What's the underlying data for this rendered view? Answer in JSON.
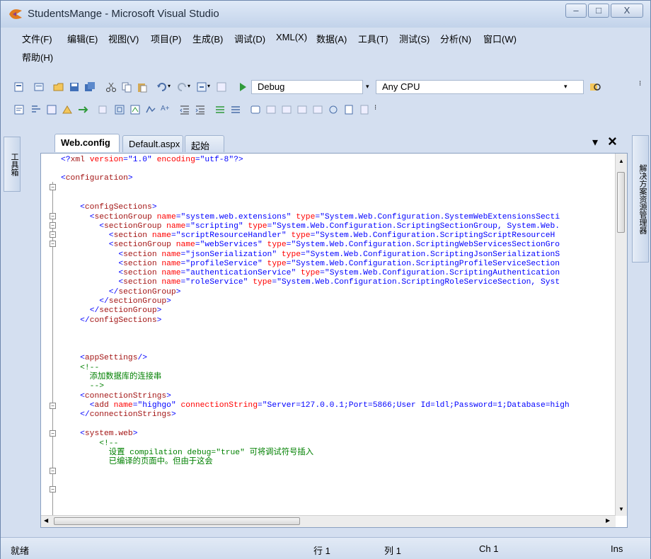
{
  "window": {
    "title": "StudentsMange - Microsoft Visual Studio",
    "minimize": "–",
    "maximize": "□",
    "close": "X"
  },
  "menu": [
    "文件(F)",
    "编辑(E)",
    "视图(V)",
    "项目(P)",
    "生成(B)",
    "调试(D)",
    "XML(X)",
    "数据(A)",
    "工具(T)",
    "测试(S)",
    "分析(N)",
    "窗口(W)",
    "帮助(H)"
  ],
  "toolbar": {
    "config_combo": "Debug",
    "platform_combo": "Any CPU"
  },
  "side_panels": {
    "left_toolbox": "工具箱",
    "right_solution_explorer": "解决方案资源管理器"
  },
  "tabs": [
    {
      "label": "Web.config",
      "active": true
    },
    {
      "label": "Default.aspx",
      "active": false
    },
    {
      "label": "起始页",
      "active": false
    }
  ],
  "tab_controls": {
    "dropdown": "▾",
    "close": "×"
  },
  "code_lines": [
    "<?xml version=\"1.0\" encoding=\"utf-8\"?>",
    "",
    "<configuration>",
    "",
    "",
    "    <configSections>",
    "      <sectionGroup name=\"system.web.extensions\" type=\"System.Web.Configuration.SystemWebExtensionsSecti",
    "        <sectionGroup name=\"scripting\" type=\"System.Web.Configuration.ScriptingSectionGroup, System.Web.",
    "          <section name=\"scriptResourceHandler\" type=\"System.Web.Configuration.ScriptingScriptResourceH",
    "          <sectionGroup name=\"webServices\" type=\"System.Web.Configuration.ScriptingWebServicesSectionGro",
    "            <section name=\"jsonSerialization\" type=\"System.Web.Configuration.ScriptingJsonSerializationS",
    "            <section name=\"profileService\" type=\"System.Web.Configuration.ScriptingProfileServiceSection",
    "            <section name=\"authenticationService\" type=\"System.Web.Configuration.ScriptingAuthentication",
    "            <section name=\"roleService\" type=\"System.Web.Configuration.ScriptingRoleServiceSection, Syst",
    "          </sectionGroup>",
    "        </sectionGroup>",
    "      </sectionGroup>",
    "    </configSections>",
    "",
    "",
    "",
    "    <appSettings/>",
    "    <!--",
    "      添加数据库的连接串",
    "      -->",
    "    <connectionStrings>",
    "      <add name=\"highgo\" connectionString=\"Server=127.0.0.1;Port=5866;User Id=ldl;Password=1;Database=high",
    "    </connectionStrings>",
    "",
    "    <system.web>",
    "        <!--",
    "          设置 compilation debug=\"true\" 可将调试符号插入",
    "          已编译的页面中。但由于这会"
  ],
  "status": {
    "ready": "就绪",
    "line": "行 1",
    "col": "列 1",
    "ch": "Ch 1",
    "mode": "Ins"
  }
}
